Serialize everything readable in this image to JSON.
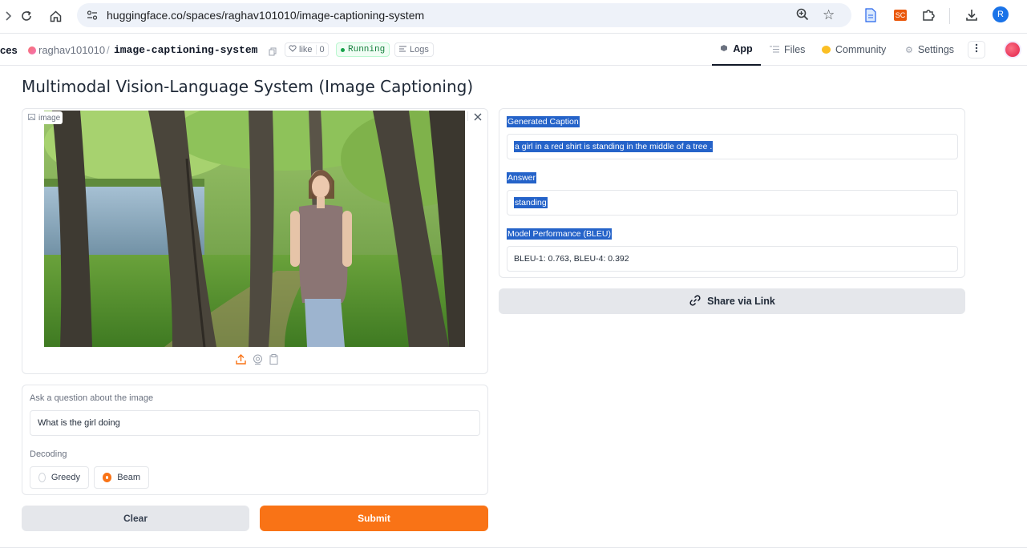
{
  "browser": {
    "url": "huggingface.co/spaces/raghav101010/image-captioning-system",
    "profile_initial": "R",
    "extension_label": "SC"
  },
  "space_header": {
    "section_fragment": "ces",
    "owner": "raghav101010",
    "separator": "/",
    "repo": "image-captioning-system",
    "like_label": "like",
    "like_count": "0",
    "status": "Running",
    "logs_label": "Logs",
    "tabs": [
      {
        "label": "App"
      },
      {
        "label": "Files"
      },
      {
        "label": "Community"
      },
      {
        "label": "Settings"
      }
    ]
  },
  "app": {
    "title": "Multimodal Vision-Language System (Image Captioning)",
    "image_label": "image",
    "question_label": "Ask a question about the image",
    "question_value": "What is the girl doing",
    "decoding_label": "Decoding",
    "decoding_options": [
      "Greedy",
      "Beam"
    ],
    "decoding_selected": "Beam",
    "clear_label": "Clear",
    "submit_label": "Submit",
    "caption_label": "Generated Caption",
    "caption_value": "a girl in a red shirt is standing in the middle of a tree .",
    "answer_label": "Answer",
    "answer_value": "standing",
    "bleu_label": "Model Performance (BLEU)",
    "bleu_value": "BLEU-1: 0.763, BLEU-4: 0.392",
    "share_label": "Share via Link"
  },
  "colors": {
    "accent": "#f97316",
    "selection": "#2563c9",
    "running": "#16a34a"
  }
}
